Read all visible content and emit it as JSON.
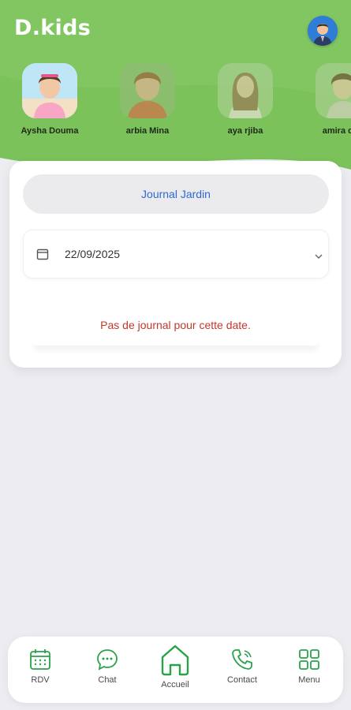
{
  "app": {
    "title": "D.kids"
  },
  "kids": [
    {
      "name": "Aysha Douma"
    },
    {
      "name": "arbia Mina"
    },
    {
      "name": "aya rjiba"
    },
    {
      "name": "amira dou"
    }
  ],
  "journal": {
    "button_label": "Journal Jardin",
    "date_value": "22/09/2025",
    "empty_message": "Pas de journal pour cette date."
  },
  "nav": {
    "items": [
      {
        "label": "RDV",
        "icon": "calendar-icon"
      },
      {
        "label": "Chat",
        "icon": "chat-icon"
      },
      {
        "label": "Accueil",
        "icon": "home-icon"
      },
      {
        "label": "Contact",
        "icon": "phone-icon"
      },
      {
        "label": "Menu",
        "icon": "grid-icon"
      }
    ]
  },
  "colors": {
    "brand_green": "#7cc25a",
    "nav_green": "#2aa24a",
    "link_blue": "#2e6ad1",
    "error_red": "#c0392b",
    "background": "#ececf1"
  }
}
